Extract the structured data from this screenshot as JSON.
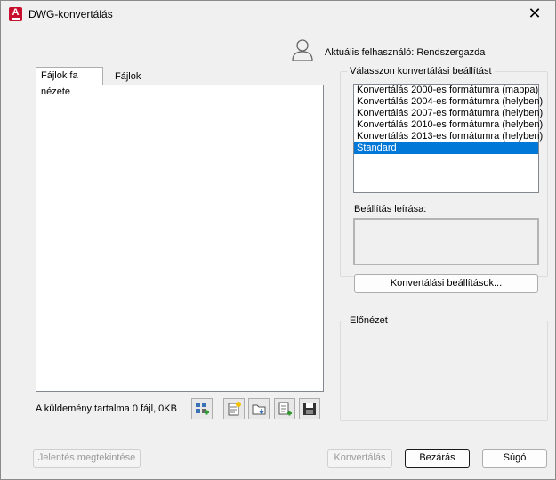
{
  "window": {
    "title": "DWG-konvertálás",
    "close_symbol": "✕",
    "app_icon_letter": "A"
  },
  "user": {
    "label": "Aktuális felhasználó: Rendszergazda"
  },
  "tabs": [
    {
      "label": "Fájlok fa nézete",
      "active": true
    },
    {
      "label": "Fájlok táblázata",
      "active": false
    }
  ],
  "tree": {
    "status": "A küldemény tartalma 0 fájl, 0KB"
  },
  "toolbar": [
    {
      "name": "add-files-button",
      "icon": "add-files-icon"
    },
    {
      "name": "new-sheet-button",
      "icon": "new-document-icon"
    },
    {
      "name": "open-folder-button",
      "icon": "open-folder-icon"
    },
    {
      "name": "add-list-button",
      "icon": "add-list-icon"
    },
    {
      "name": "save-button",
      "icon": "save-icon"
    }
  ],
  "conversion": {
    "group_label": "Válasszon konvertálási beállítást",
    "options": [
      "Konvertálás 2000-es formátumra (mappa)",
      "Konvertálás 2004-es formátumra (helyben)",
      "Konvertálás 2007-es formátumra (helyben)",
      "Konvertálás 2010-es formátumra (helyben)",
      "Konvertálás 2013-es formátumra (helyben)",
      "Standard"
    ],
    "selected_index": 5,
    "description_label": "Beállítás leírása:",
    "settings_button": "Konvertálási beállítások..."
  },
  "preview": {
    "label": "Előnézet"
  },
  "footer": {
    "view_report": "Jelentés megtekintése",
    "convert": "Konvertálás",
    "close": "Bezárás",
    "help": "Súgó"
  },
  "colors": {
    "selection": "#0078d7",
    "brand": "#c8102e"
  }
}
